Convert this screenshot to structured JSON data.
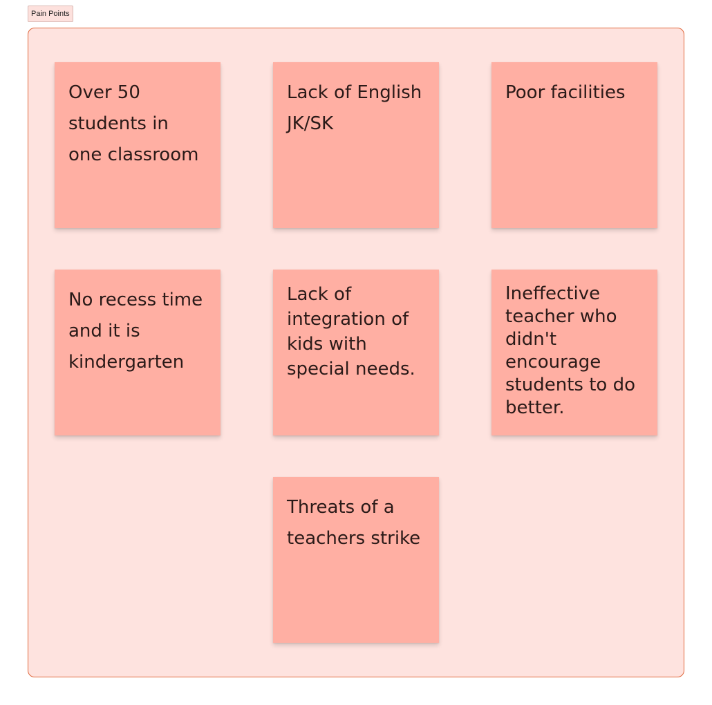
{
  "frame": {
    "title": "Pain Points",
    "colors": {
      "background": "#fee3df",
      "border": "#e0663a",
      "sticky": "#ffafa3"
    }
  },
  "stickies": [
    {
      "text": "Over 50 students in one classroom"
    },
    {
      "text": "Lack of English JK/SK"
    },
    {
      "text": "Poor facilities"
    },
    {
      "text": "No recess time and it is kindergarten"
    },
    {
      "text": "Lack of integration of kids with special needs."
    },
    {
      "text": "Ineffective teacher who didn't encourage students to do better."
    },
    {
      "text": "Threats of a teachers strike"
    }
  ]
}
